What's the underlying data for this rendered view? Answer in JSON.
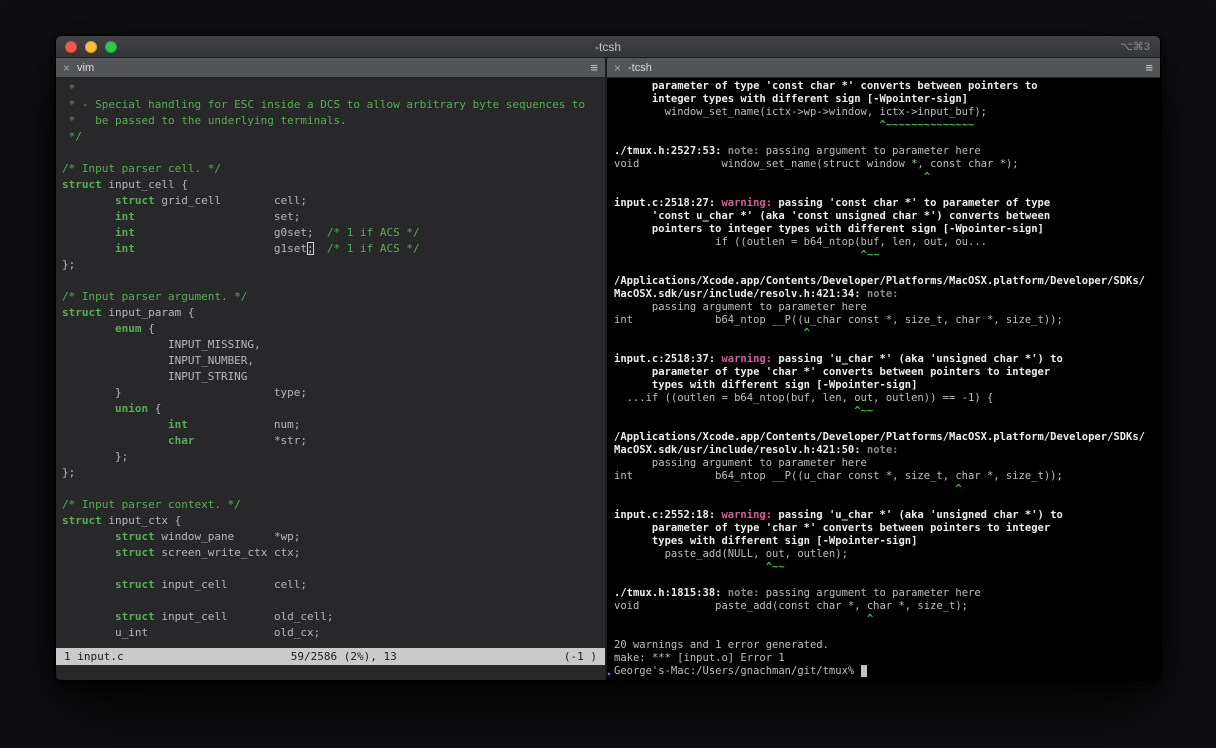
{
  "window": {
    "title": "-tcsh",
    "shortcut_hint": "⌥⌘3"
  },
  "colors": {
    "green": "#55ae54",
    "bright_green": "#3fbb3f",
    "magenta": "#cf5f9e",
    "note_gray": "#8a8a8a",
    "statusline_bg": "#cacaca"
  },
  "left_pane": {
    "tab": {
      "close_label": "×",
      "title": "vim",
      "menu_icon": "≡"
    },
    "statusline": {
      "buffer": "1 input.c",
      "position": "59/2586 (2%), 13",
      "right": "(-1 )"
    },
    "editor_lines": [
      [
        [
          " *",
          "c"
        ]
      ],
      [
        [
          " * - Special handling for ESC inside a DCS to allow arbitrary byte sequences to",
          "c"
        ]
      ],
      [
        [
          " *   be passed to the underlying terminals.",
          "c"
        ]
      ],
      [
        [
          " */",
          "c"
        ]
      ],
      [],
      [
        [
          "/* Input parser cell. */",
          "c"
        ]
      ],
      [
        [
          "struct",
          "k"
        ],
        [
          " input_cell {",
          ""
        ]
      ],
      [
        [
          "        ",
          ""
        ],
        [
          "struct",
          "k"
        ],
        [
          " grid_cell        cell;",
          ""
        ]
      ],
      [
        [
          "        ",
          ""
        ],
        [
          "int",
          "k"
        ],
        [
          "                     set;",
          ""
        ]
      ],
      [
        [
          "        ",
          ""
        ],
        [
          "int",
          "k"
        ],
        [
          "                     g0set;  ",
          ""
        ],
        [
          "/* 1 if ACS */",
          "c"
        ]
      ],
      [
        [
          "        ",
          ""
        ],
        [
          "int",
          "k"
        ],
        [
          "                     g1set",
          ""
        ],
        [
          ";",
          "hc"
        ],
        [
          "  ",
          ""
        ],
        [
          "/* 1 if ACS */",
          "c"
        ]
      ],
      [
        [
          "};",
          ""
        ]
      ],
      [],
      [
        [
          "/* Input parser argument. */",
          "c"
        ]
      ],
      [
        [
          "struct",
          "k"
        ],
        [
          " input_param {",
          ""
        ]
      ],
      [
        [
          "        ",
          ""
        ],
        [
          "enum",
          "k"
        ],
        [
          " {",
          ""
        ]
      ],
      [
        [
          "                INPUT_MISSING,",
          ""
        ]
      ],
      [
        [
          "                INPUT_NUMBER,",
          ""
        ]
      ],
      [
        [
          "                INPUT_STRING",
          ""
        ]
      ],
      [
        [
          "        }                       type;",
          ""
        ]
      ],
      [
        [
          "        ",
          ""
        ],
        [
          "union",
          "k"
        ],
        [
          " {",
          ""
        ]
      ],
      [
        [
          "                ",
          ""
        ],
        [
          "int",
          "k"
        ],
        [
          "             num;",
          ""
        ]
      ],
      [
        [
          "                ",
          ""
        ],
        [
          "char",
          "k"
        ],
        [
          "            *str;",
          ""
        ]
      ],
      [
        [
          "        };",
          ""
        ]
      ],
      [
        [
          "};",
          ""
        ]
      ],
      [],
      [
        [
          "/* Input parser context. */",
          "c"
        ]
      ],
      [
        [
          "struct",
          "k"
        ],
        [
          " input_ctx {",
          ""
        ]
      ],
      [
        [
          "        ",
          ""
        ],
        [
          "struct",
          "k"
        ],
        [
          " window_pane      *wp;",
          ""
        ]
      ],
      [
        [
          "        ",
          ""
        ],
        [
          "struct",
          "k"
        ],
        [
          " screen_write_ctx ctx;",
          ""
        ]
      ],
      [],
      [
        [
          "        ",
          ""
        ],
        [
          "struct",
          "k"
        ],
        [
          " input_cell       cell;",
          ""
        ]
      ],
      [],
      [
        [
          "        ",
          ""
        ],
        [
          "struct",
          "k"
        ],
        [
          " input_cell       old_cell;",
          ""
        ]
      ],
      [
        [
          "        u_int                   old_cx;",
          ""
        ]
      ]
    ]
  },
  "right_pane": {
    "tab": {
      "close_label": "×",
      "title": "-tcsh",
      "menu_icon": "≡"
    },
    "prompt_mark": "▸",
    "terminal_lines": [
      [
        [
          "      parameter of type 'const char *' converts between pointers to",
          "b"
        ]
      ],
      [
        [
          "      integer types with different sign [-Wpointer-sign]",
          "b"
        ]
      ],
      [
        [
          "        window_set_name(ictx->wp->window, ictx->input_buf);",
          ""
        ]
      ],
      [
        [
          "                                          ",
          ""
        ],
        [
          "^~~~~~~~~~~~~~~",
          "g"
        ]
      ],
      [],
      [
        [
          "./tmux.h:2527:53: ",
          "b"
        ],
        [
          "note: ",
          "n"
        ],
        [
          "passing argument to parameter here",
          ""
        ]
      ],
      [
        [
          "void             window_set_name(struct window *, const char *);",
          ""
        ]
      ],
      [
        [
          "                                                 ",
          ""
        ],
        [
          "^",
          "g"
        ]
      ],
      [],
      [
        [
          "input.c:2518:27: ",
          "b"
        ],
        [
          "warning: ",
          "w"
        ],
        [
          "passing 'const char *' to parameter of type",
          "b"
        ]
      ],
      [
        [
          "      'const u_char *' (aka 'const unsigned char *') converts between",
          "b"
        ]
      ],
      [
        [
          "      pointers to integer types with different sign [-Wpointer-sign]",
          "b"
        ]
      ],
      [
        [
          "                if ((outlen = b64_ntop(buf, len, out, ou...",
          ""
        ]
      ],
      [
        [
          "                                       ",
          ""
        ],
        [
          "^~~",
          "g"
        ]
      ],
      [],
      [
        [
          "/Applications/Xcode.app/Contents/Developer/Platforms/MacOSX.platform/Developer/SDKs/",
          "b"
        ]
      ],
      [
        [
          "MacOSX.sdk/usr/include/resolv.h:421:34: ",
          "b"
        ],
        [
          "note:",
          "n"
        ]
      ],
      [
        [
          "      passing argument to parameter here",
          ""
        ]
      ],
      [
        [
          "int             b64_ntop __P((u_char const *, size_t, char *, size_t));",
          ""
        ]
      ],
      [
        [
          "                              ",
          ""
        ],
        [
          "^",
          "g"
        ]
      ],
      [],
      [
        [
          "input.c:2518:37: ",
          "b"
        ],
        [
          "warning: ",
          "w"
        ],
        [
          "passing 'u_char *' (aka 'unsigned char *') to",
          "b"
        ]
      ],
      [
        [
          "      parameter of type 'char *' converts between pointers to integer",
          "b"
        ]
      ],
      [
        [
          "      types with different sign [-Wpointer-sign]",
          "b"
        ]
      ],
      [
        [
          "  ...if ((outlen = b64_ntop(buf, len, out, outlen)) == -1) {",
          ""
        ]
      ],
      [
        [
          "                                      ",
          ""
        ],
        [
          "^~~",
          "g"
        ]
      ],
      [],
      [
        [
          "/Applications/Xcode.app/Contents/Developer/Platforms/MacOSX.platform/Developer/SDKs/",
          "b"
        ]
      ],
      [
        [
          "MacOSX.sdk/usr/include/resolv.h:421:50: ",
          "b"
        ],
        [
          "note:",
          "n"
        ]
      ],
      [
        [
          "      passing argument to parameter here",
          ""
        ]
      ],
      [
        [
          "int             b64_ntop __P((u_char const *, size_t, char *, size_t));",
          ""
        ]
      ],
      [
        [
          "                                                      ",
          ""
        ],
        [
          "^",
          "g"
        ]
      ],
      [],
      [
        [
          "input.c:2552:18: ",
          "b"
        ],
        [
          "warning: ",
          "w"
        ],
        [
          "passing 'u_char *' (aka 'unsigned char *') to",
          "b"
        ]
      ],
      [
        [
          "      parameter of type 'char *' converts between pointers to integer",
          "b"
        ]
      ],
      [
        [
          "      types with different sign [-Wpointer-sign]",
          "b"
        ]
      ],
      [
        [
          "        paste_add(NULL, out, outlen);",
          ""
        ]
      ],
      [
        [
          "                        ",
          ""
        ],
        [
          "^~~",
          "g"
        ]
      ],
      [],
      [
        [
          "./tmux.h:1815:38: ",
          "b"
        ],
        [
          "note: ",
          "n"
        ],
        [
          "passing argument to parameter here",
          ""
        ]
      ],
      [
        [
          "void            paste_add(const char *, char *, size_t);",
          ""
        ]
      ],
      [
        [
          "                                        ",
          ""
        ],
        [
          "^",
          "g"
        ]
      ],
      [],
      [
        [
          "20 warnings and 1 error generated.",
          ""
        ]
      ],
      [
        [
          "make: *** [input.o] Error 1",
          ""
        ]
      ],
      [
        [
          "▸",
          "m"
        ],
        [
          "George's-Mac:/Users/gnachman/git/tmux% ",
          ""
        ],
        [
          " ",
          "cur"
        ]
      ]
    ]
  }
}
